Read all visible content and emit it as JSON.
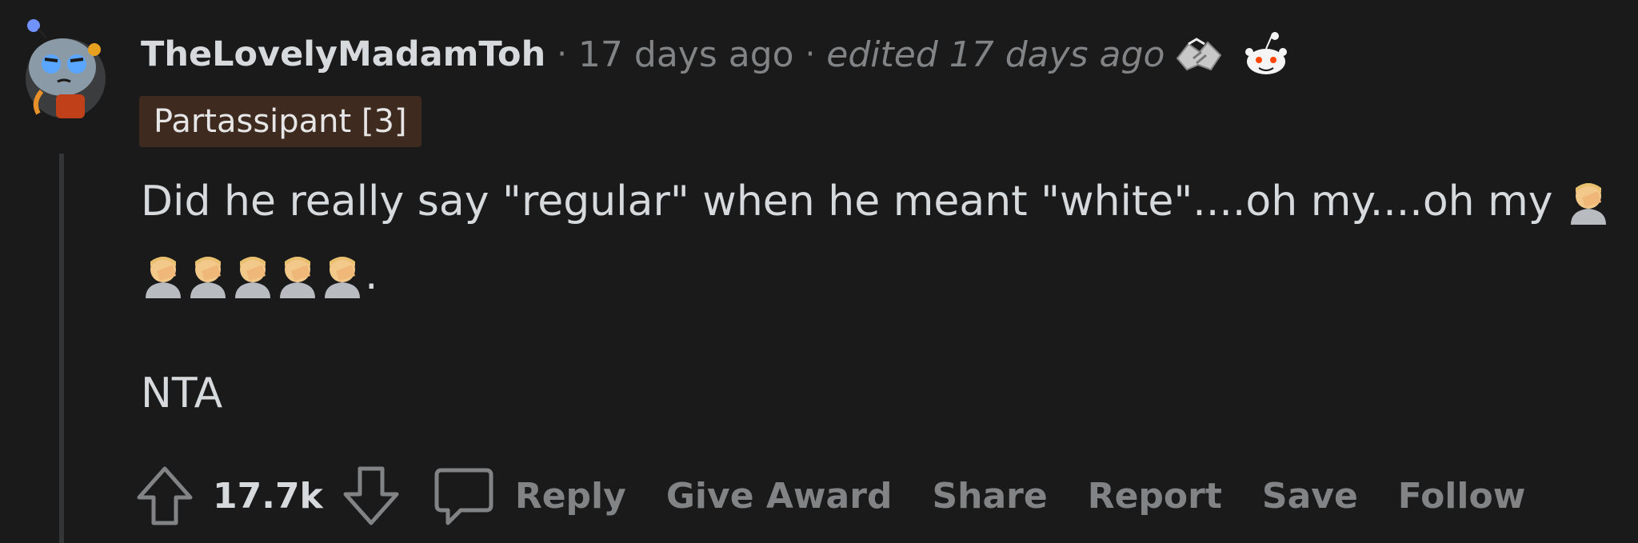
{
  "comment": {
    "username": "TheLovelyMadamToh",
    "separator": "·",
    "time": "17 days ago",
    "edited": "edited 17 days ago",
    "flair": "Partassipant [3]",
    "body": {
      "line1": "Did he really say \"regular\" when he meant \"white\"....oh my....oh my",
      "line2_end": ".",
      "line3": "NTA"
    },
    "score": "17.7k",
    "actions": {
      "reply": "Reply",
      "give_award": "Give Award",
      "share": "Share",
      "report": "Report",
      "save": "Save",
      "follow": "Follow"
    }
  },
  "icons": [
    "avatar",
    "handshake-award-icon",
    "snoo-award-icon",
    "facepalm-emoji-icon",
    "upvote-arrow-icon",
    "downvote-arrow-icon",
    "comment-bubble-icon"
  ],
  "colors": {
    "background": "#1a1a1b",
    "text": "#d7dadc",
    "muted": "#818384",
    "flair_bg": "#3f2a20"
  }
}
